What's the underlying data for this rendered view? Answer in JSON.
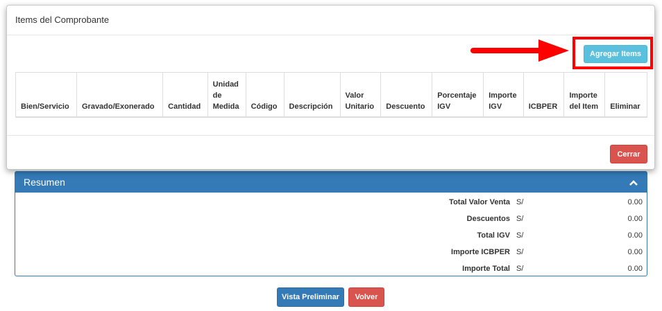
{
  "modal": {
    "title": "Items del Comprobante",
    "add_button": "Agregar Items",
    "close_button": "Cerrar",
    "columns": [
      "Bien/Servicio",
      "Gravado/Exonerado",
      "Cantidad",
      "Unidad\nde\nMedida",
      "Código",
      "Descripción",
      "Valor\nUnitario",
      "Descuento",
      "Porcentaje\nIGV",
      "Importe\nIGV",
      "ICBPER",
      "Importe\ndel Item",
      "Eliminar"
    ]
  },
  "resumen": {
    "title": "Resumen",
    "rows": [
      {
        "label": "Total Valor Venta",
        "currency": "S/",
        "value": "0.00"
      },
      {
        "label": "Descuentos",
        "currency": "S/",
        "value": "0.00"
      },
      {
        "label": "Total IGV",
        "currency": "S/",
        "value": "0.00"
      },
      {
        "label": "Importe ICBPER",
        "currency": "S/",
        "value": "0.00"
      },
      {
        "label": "Importe Total",
        "currency": "S/",
        "value": "0.00"
      }
    ]
  },
  "actions": {
    "preview": "Vista Preliminar",
    "back": "Volver"
  },
  "colors": {
    "primary": "#337ab7",
    "danger": "#d9534f",
    "info": "#5bc0de",
    "annotation": "#ff0000"
  }
}
